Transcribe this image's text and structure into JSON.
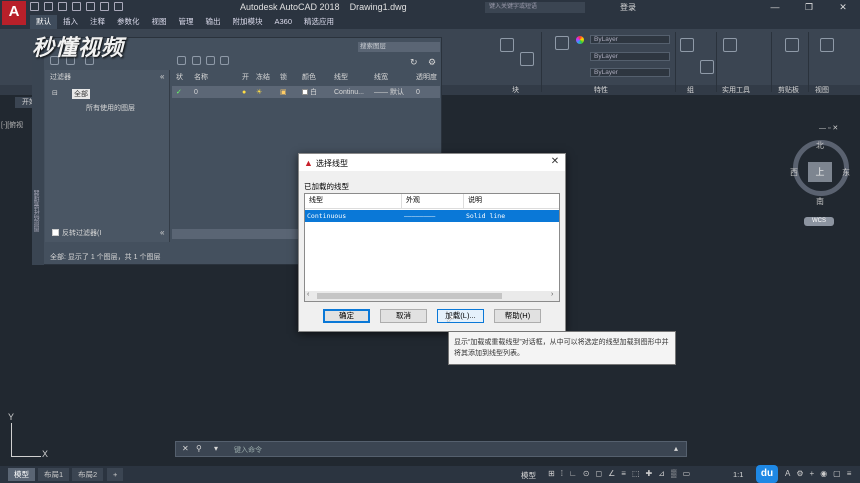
{
  "app": {
    "logo": "A",
    "title": "Autodesk AutoCAD 2018    Drawing1.dwg",
    "search_placeholder": "键入关键字或短语",
    "login": "登录"
  },
  "menu": {
    "items": [
      "默认",
      "插入",
      "注释",
      "参数化",
      "视图",
      "管理",
      "输出",
      "附加模块",
      "A360",
      "精选应用"
    ]
  },
  "ribbon": {
    "groups": [
      "块",
      "特性",
      "组",
      "实用工具",
      "剪贴板",
      "视图"
    ],
    "bylayer": "ByLayer"
  },
  "watermark": "秒懂视频",
  "file_tab": "开始",
  "viewport_label": "[-][俯视",
  "layer_palette": {
    "search_placeholder": "搜索图层",
    "strip_label": "图层特性管理器",
    "filter_header": "过滤器",
    "filter_all": "全部",
    "filter_used": "所有使用的图层",
    "invert_filter": "反转过滤器(I",
    "status": "全部: 显示了 1 个图层，共 1 个图层",
    "columns": [
      "状",
      "名称",
      "开",
      "冻结",
      "锁",
      "颜色",
      "线型",
      "线宽",
      "透明度"
    ],
    "row": {
      "status": "✓",
      "name": "0",
      "color": "白",
      "linetype": "Continu...",
      "lineweight": "—— 默认",
      "transparency": "0"
    }
  },
  "dialog": {
    "title": "选择线型",
    "loaded_label": "已加载的线型",
    "columns": [
      "线型",
      "外观",
      "说明"
    ],
    "rows": [
      {
        "linetype": "Continuous",
        "appearance": "————————",
        "description": "Solid line"
      }
    ],
    "buttons": {
      "ok": "确定",
      "cancel": "取消",
      "load": "加载(L)...",
      "help": "帮助(H)"
    }
  },
  "tooltip": "显示“加载或重载线型”对话框，从中可以将选定的线型加载到图形中并将其添加到线型列表。",
  "viewcube": {
    "north": "北",
    "south": "南",
    "east": "东",
    "west": "西",
    "face": "上",
    "wcs": "WCS"
  },
  "command_line": {
    "placeholder": "键入命令"
  },
  "ucs": {
    "x": "X",
    "y": "Y"
  },
  "status_bar": {
    "tabs": [
      "模型",
      "布局1",
      "布局2"
    ],
    "add_tab": "+",
    "model": "模型",
    "scale": "1:1"
  },
  "colors": {
    "accent": "#0a78d7",
    "background": "#212830",
    "logo": "#b8202a"
  }
}
